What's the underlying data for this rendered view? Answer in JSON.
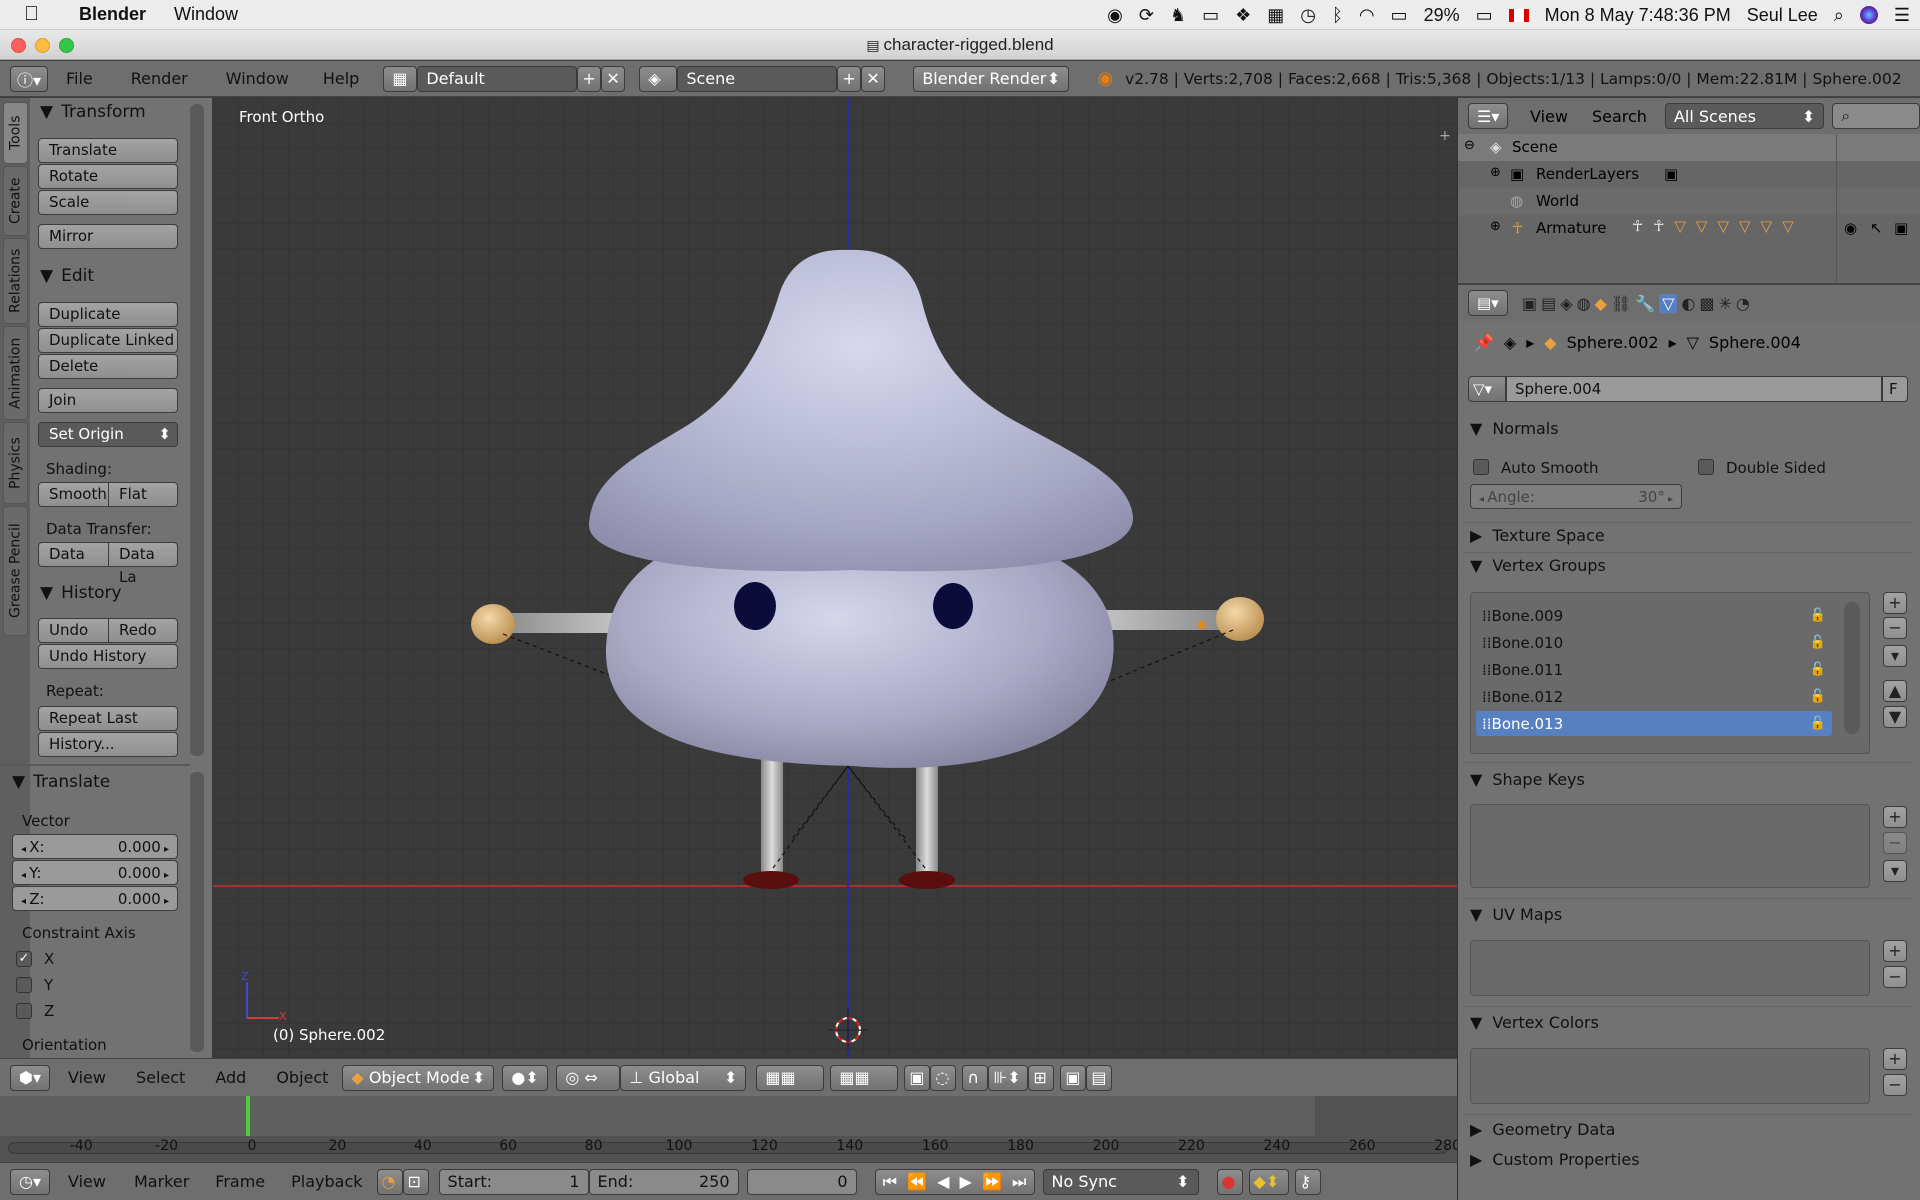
{
  "macbar": {
    "app": "Blender",
    "menu": "Window",
    "battery": "29%",
    "datetime": "Mon 8 May  7:48:36 PM",
    "user": "Seul Lee"
  },
  "window": {
    "title": "character-rigged.blend"
  },
  "top_header": {
    "menus": [
      "File",
      "Render",
      "Window",
      "Help"
    ],
    "layout": "Default",
    "scene": "Scene",
    "engine": "Blender Render",
    "stats": "v2.78 | Verts:2,708 | Faces:2,668 | Tris:5,368 | Objects:1/13 | Lamps:0/0 | Mem:22.81M | Sphere.002"
  },
  "tool_tabs": [
    "Tools",
    "Create",
    "Relations",
    "Animation",
    "Physics",
    "Grease Pencil"
  ],
  "tools": {
    "transform": {
      "title": "Transform",
      "buttons": [
        "Translate",
        "Rotate",
        "Scale",
        "Mirror"
      ]
    },
    "edit": {
      "title": "Edit",
      "buttons": [
        "Duplicate",
        "Duplicate Linked",
        "Delete",
        "Join",
        "Set Origin"
      ],
      "shading_label": "Shading:",
      "shading": [
        "Smooth",
        "Flat"
      ],
      "data_transfer_label": "Data Transfer:",
      "data_transfer": [
        "Data",
        "Data La"
      ]
    },
    "history": {
      "title": "History",
      "undo": "Undo",
      "redo": "Redo",
      "undo_history": "Undo History",
      "repeat_label": "Repeat:",
      "repeat_last": "Repeat Last",
      "history_btn": "History..."
    }
  },
  "operator": {
    "title": "Translate",
    "vector_label": "Vector",
    "x_label": "X:",
    "x": "0.000",
    "y_label": "Y:",
    "y": "0.000",
    "z_label": "Z:",
    "z": "0.000",
    "constraint_label": "Constraint Axis",
    "axes": [
      "X",
      "Y",
      "Z"
    ],
    "orientation_label": "Orientation"
  },
  "viewport": {
    "view_name": "Front Ortho",
    "object_label": "(0) Sphere.002",
    "axis_z": "Z",
    "axis_x": "X"
  },
  "viewport_header": {
    "menus": [
      "View",
      "Select",
      "Add",
      "Object"
    ],
    "mode": "Object Mode",
    "orientation": "Global"
  },
  "timeline": {
    "ticks": [
      "-40",
      "-20",
      "0",
      "20",
      "40",
      "60",
      "80",
      "100",
      "120",
      "140",
      "160",
      "180",
      "200",
      "220",
      "240",
      "260",
      "280"
    ],
    "current_frame": 0
  },
  "timeline_header": {
    "menus": [
      "View",
      "Marker",
      "Frame",
      "Playback"
    ],
    "start_label": "Start:",
    "start": "1",
    "end_label": "End:",
    "end": "250",
    "frame": "0",
    "sync": "No Sync"
  },
  "outliner": {
    "menus": [
      "View",
      "Search"
    ],
    "filter": "All Scenes",
    "items": [
      "Scene",
      "RenderLayers",
      "World",
      "Armature"
    ]
  },
  "properties": {
    "breadcrumb": [
      "Sphere.002",
      "Sphere.004"
    ],
    "datablock": "Sphere.004",
    "datablock_flag": "F",
    "normals": {
      "title": "Normals",
      "auto_smooth": "Auto Smooth",
      "double_sided": "Double Sided",
      "angle_label": "Angle:",
      "angle": "30°"
    },
    "texture_space": "Texture Space",
    "vertex_groups": {
      "title": "Vertex Groups",
      "items": [
        "Bone.009",
        "Bone.010",
        "Bone.011",
        "Bone.012",
        "Bone.013"
      ],
      "selected": "Bone.013"
    },
    "shape_keys": "Shape Keys",
    "uv_maps": "UV Maps",
    "vertex_colors": "Vertex Colors",
    "geometry_data": "Geometry Data",
    "custom_properties": "Custom Properties"
  },
  "colors": {
    "accent_selection": "#5680c2",
    "x_axis": "#a83232",
    "z_axis": "#3232a8",
    "current_frame": "#4ccc3f"
  }
}
